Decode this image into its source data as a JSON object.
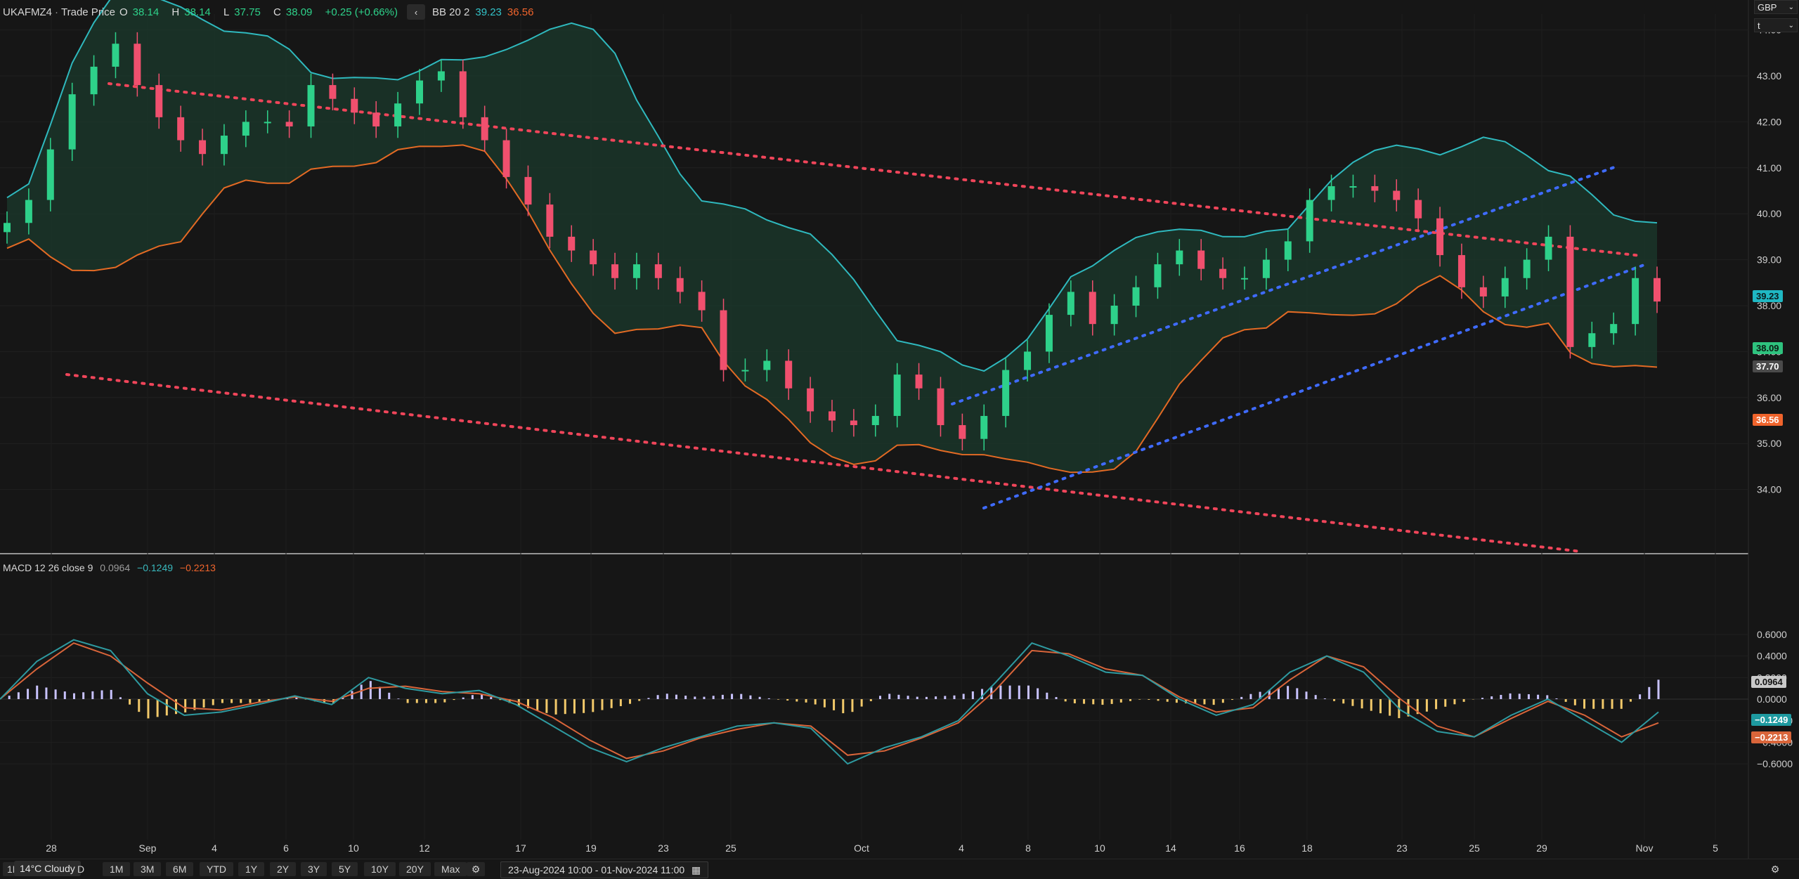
{
  "instrument": {
    "symbol": "UKAFMZ4",
    "field": "Trade Price",
    "open_label": "O",
    "open": "38.14",
    "high_label": "H",
    "high": "38.14",
    "low_label": "L",
    "low": "37.75",
    "close_label": "C",
    "close": "38.09",
    "change": "+0.25 (+0.66%)"
  },
  "bollinger": {
    "label": "BB 20 2",
    "upper": "39.23",
    "lower": "36.56"
  },
  "macd": {
    "label": "MACD 12 26 close 9",
    "hist": "0.0964",
    "macd": "−0.1249",
    "signal": "−0.2213"
  },
  "selectors": {
    "currency": "GBP",
    "unit": "t"
  },
  "price_axis": {
    "ticks": [
      "44.00",
      "43.00",
      "42.00",
      "41.00",
      "40.00",
      "39.00",
      "38.00",
      "37.00",
      "36.00",
      "35.00",
      "34.00"
    ],
    "tags": {
      "upper": "39.23",
      "last": "38.09",
      "prev": "37.70",
      "lower": "36.56"
    }
  },
  "macd_axis": {
    "ticks": [
      "0.6000",
      "0.4000",
      "0.2000",
      "0.0000",
      "−0.2000",
      "−0.4000",
      "−0.6000"
    ],
    "tags": {
      "hist": "0.0964",
      "hist_zero": "0.0000",
      "macd": "−0.1249",
      "signal": "−0.2213"
    }
  },
  "time_axis": [
    "28",
    "Sep",
    "4",
    "6",
    "10",
    "12",
    "17",
    "19",
    "23",
    "25",
    "Oct",
    "4",
    "8",
    "10",
    "14",
    "16",
    "18",
    "23",
    "25",
    "29",
    "Nov",
    "5"
  ],
  "toolbar": {
    "weather": "14°C Cloudy",
    "cut_left": "1D",
    "ranges": [
      "D",
      "1M",
      "3M",
      "6M",
      "YTD",
      "1Y",
      "2Y",
      "3Y",
      "5Y",
      "10Y",
      "20Y",
      "Max"
    ],
    "date_range": "23-Aug-2024 10:00  -  01-Nov-2024 11:00"
  },
  "colors": {
    "up": "#2ed18a",
    "down": "#f0506e",
    "bb_upper": "#2fb9be",
    "bb_lower": "#e36a24",
    "bb_fill": "#1b3a2c",
    "trend_red": "#f0455a",
    "trend_blue": "#3f6bff",
    "macd_line": "#2e9aa0",
    "signal_line": "#d9653a",
    "hist_pos": "#c9c3ff",
    "hist_neg": "#f2c96a"
  },
  "chart_data": [
    {
      "type": "candlestick",
      "title": "UKAFMZ4 · Trade Price",
      "ylim": [
        33.7,
        45.0
      ],
      "indicators": [
        "BB 20 2"
      ],
      "series": [
        {
          "name": "Close",
          "values": [
            39.8,
            40.3,
            41.4,
            42.6,
            43.2,
            43.7,
            42.8,
            42.1,
            41.6,
            41.3,
            41.7,
            42.0,
            42.0,
            41.9,
            42.8,
            42.5,
            42.2,
            41.9,
            42.4,
            42.9,
            43.1,
            42.1,
            41.6,
            40.8,
            40.2,
            39.5,
            39.2,
            38.9,
            38.6,
            38.9,
            38.6,
            38.3,
            37.9,
            36.6,
            36.6,
            36.8,
            36.2,
            35.7,
            35.5,
            35.4,
            35.6,
            36.5,
            36.2,
            35.4,
            35.1,
            35.6,
            36.6,
            37.0,
            37.8,
            38.3,
            37.6,
            38.0,
            38.4,
            38.9,
            39.2,
            38.8,
            38.6,
            38.6,
            39.0,
            39.4,
            40.3,
            40.6,
            40.6,
            40.5,
            40.3,
            39.9,
            39.1,
            38.4,
            38.2,
            38.6,
            39.0,
            39.5,
            37.1,
            37.4,
            37.6,
            38.6,
            38.09
          ]
        }
      ]
    },
    {
      "type": "line",
      "title": "MACD 12 26 close 9",
      "ylim": [
        -0.75,
        0.75
      ],
      "series": [
        {
          "name": "MACD",
          "values": [
            0.0,
            0.35,
            0.55,
            0.45,
            0.05,
            -0.15,
            -0.12,
            -0.05,
            0.03,
            -0.05,
            0.2,
            0.1,
            0.05,
            0.08,
            -0.05,
            -0.25,
            -0.45,
            -0.58,
            -0.45,
            -0.35,
            -0.25,
            -0.22,
            -0.27,
            -0.6,
            -0.45,
            -0.35,
            -0.2,
            0.15,
            0.52,
            0.4,
            0.25,
            0.22,
            0.0,
            -0.15,
            -0.05,
            0.25,
            0.4,
            0.25,
            -0.1,
            -0.3,
            -0.35,
            -0.15,
            0.0,
            -0.2,
            -0.4,
            -0.12
          ]
        },
        {
          "name": "Signal",
          "values": [
            0.0,
            0.28,
            0.52,
            0.4,
            0.15,
            -0.08,
            -0.1,
            -0.03,
            0.02,
            -0.02,
            0.1,
            0.12,
            0.07,
            0.05,
            -0.02,
            -0.17,
            -0.38,
            -0.55,
            -0.48,
            -0.36,
            -0.28,
            -0.22,
            -0.25,
            -0.52,
            -0.48,
            -0.36,
            -0.22,
            0.08,
            0.45,
            0.42,
            0.28,
            0.22,
            0.02,
            -0.12,
            -0.08,
            0.18,
            0.4,
            0.3,
            0.0,
            -0.25,
            -0.35,
            -0.18,
            -0.02,
            -0.15,
            -0.35,
            -0.22
          ]
        }
      ]
    }
  ]
}
